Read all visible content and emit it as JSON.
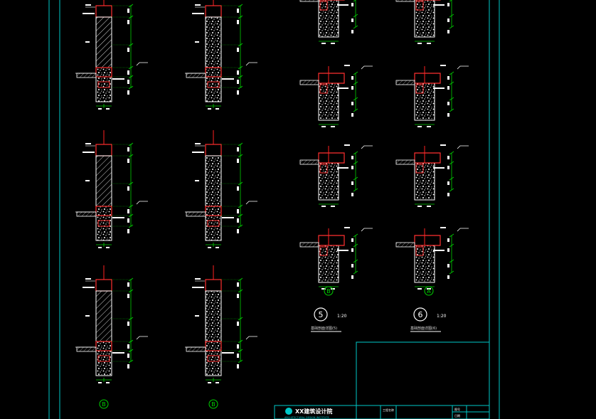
{
  "drawing": {
    "background": "#000000",
    "colors": {
      "frame": "#00c8c8",
      "wall": "#ffffff",
      "cap": "#ff3030",
      "dim": "#00d000",
      "axis": "#ff2020",
      "text": "#ffffff",
      "title_text": "#ffffff"
    },
    "left_axis_labels": [
      "B",
      "B"
    ],
    "right_axis_labels": [
      "B",
      "A"
    ],
    "sections": [
      {
        "number": "5",
        "scale": "1:20",
        "caption": "基础剖面详图(5)"
      },
      {
        "number": "6",
        "scale": "1:20",
        "caption": "基础剖面详图(6)"
      }
    ],
    "title_block": {
      "institute": "XX建筑设计院",
      "subtitle": "ARCHITECTURAL DESIGN INSTITUTE",
      "cells": [
        "工程名称",
        "图号",
        "日期"
      ]
    }
  }
}
